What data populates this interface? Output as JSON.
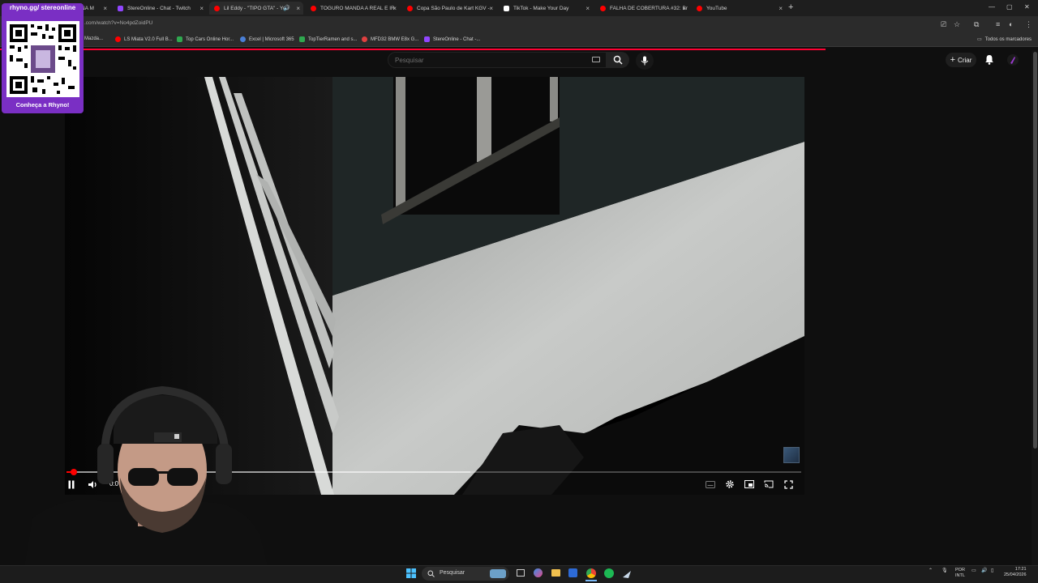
{
  "browser": {
    "tabs": [
      {
        "title": "NA M",
        "color": "#ff0000"
      },
      {
        "title": "StereOnline - Chat - Twitch",
        "color": "#9146ff"
      },
      {
        "title": "Lil Eddy - \"TIPO GTA\" - You",
        "color": "#ff0000",
        "active": true
      },
      {
        "title": "TOGURO MANDA A REAL E IR",
        "color": "#ff0000"
      },
      {
        "title": "Copa São Paulo de Kart KGV -",
        "color": "#ff0000"
      },
      {
        "title": "TikTok - Make Your Day",
        "color": "#ffffff"
      },
      {
        "title": "FALHA DE COBERTURA #32: Br",
        "color": "#ff0000"
      },
      {
        "title": "YouTube",
        "color": "#ff0000"
      }
    ],
    "url": ".com/watch?v=No4pdZoidPU",
    "bookmarks": [
      {
        "label": "Mazda...",
        "color": "#888888"
      },
      {
        "label": "LS Miata V2.0 Full B...",
        "color": "#ff0000"
      },
      {
        "label": "Top Cars Online Hor...",
        "color": "#2fa84f"
      },
      {
        "label": "Excel | Microsoft 365",
        "color": "#4a7fd6"
      },
      {
        "label": "TopTierRamen and s...",
        "color": "#2fa84f"
      },
      {
        "label": "MFD32 BMW E8x G...",
        "color": "#e04040"
      },
      {
        "label": "StereOnline - Chat -...",
        "color": "#9146ff"
      }
    ],
    "all_bookmarks": "Todos os marcadores"
  },
  "youtube": {
    "search_placeholder": "Pesquisar",
    "create_label": "Criar",
    "player": {
      "current_time": "0:0",
      "progress_fraction": 0.01,
      "buffered_fraction": 0.55
    }
  },
  "overlay": {
    "qr_title": "rhyno.gg/ stereonline",
    "qr_cta": "Conheça a Rhyno!"
  },
  "taskbar": {
    "search_label": "Pesquisar",
    "lang_line1": "POR",
    "lang_line2": "INTL",
    "time": "17:21",
    "date": "25/04/2026"
  }
}
